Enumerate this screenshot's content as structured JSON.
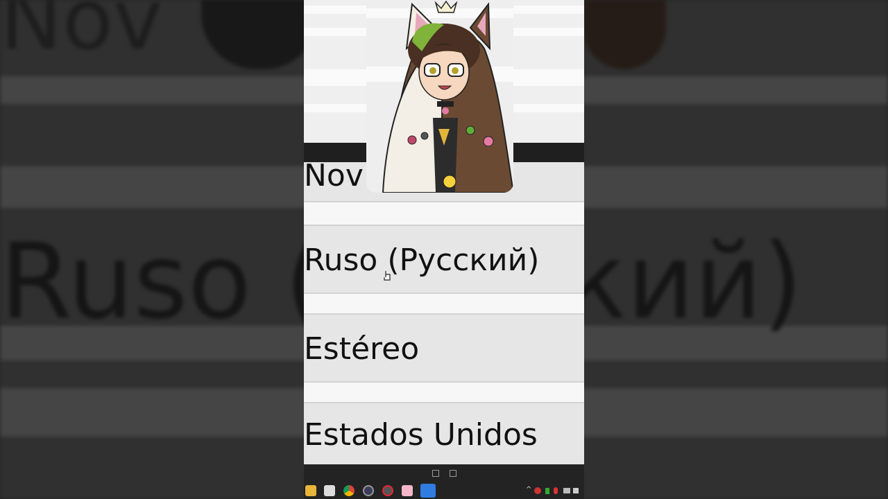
{
  "background": {
    "top_text": "Nov",
    "row1_text": "Ruso (Русский)"
  },
  "list": {
    "partial_item": "Nov",
    "items": [
      {
        "label": "Ruso (Русский)"
      },
      {
        "label": "Estéreo"
      },
      {
        "label": "Estados Unidos"
      }
    ]
  },
  "taskbar": {
    "icons": [
      "file-explorer-icon",
      "store-icon",
      "chrome-icon",
      "obs-icon",
      "gear-app-icon",
      "heart-app-icon",
      "pen-app-icon"
    ],
    "colors": {
      "accent": "#2f7de1",
      "bar": "#232323"
    }
  },
  "avatar": {
    "name": "streamer-avatar"
  }
}
